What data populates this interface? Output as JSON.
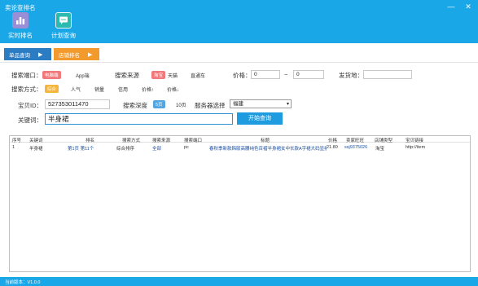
{
  "window": {
    "title": "卖论查排名",
    "minimize": "—",
    "close": "✕"
  },
  "toolbar": {
    "rank_label": "实时排名",
    "plan_label": "计划查询"
  },
  "tabs": [
    {
      "label": "单品查询",
      "arrow": "▶"
    },
    {
      "label": "店铺排名",
      "arrow": "▶"
    }
  ],
  "form": {
    "port_label": "搜索端口：",
    "port_options": [
      "电脑端",
      "App端"
    ],
    "source_label": "搜索来源",
    "source_options": [
      "淘宝",
      "天猫",
      "直通车"
    ],
    "price_label": "价格：",
    "price_min": "0",
    "price_sep": "~",
    "price_max": "0",
    "ship_label": "发货地：",
    "ship_value": "",
    "method_label": "搜索方式：",
    "method_options": [
      "综合",
      "人气",
      "销量",
      "信用",
      "价格↑",
      "价格↓"
    ],
    "item_id_label": "宝贝ID：",
    "item_id_value": "527353011470",
    "depth_label": "搜索深度",
    "depth_options": [
      "5页",
      "10页"
    ],
    "server_label": "服务器选择",
    "server_value": "福建",
    "keyword_label": "关键词：",
    "keyword_value": "半身裙",
    "start_button": "开始查询"
  },
  "table": {
    "headers": [
      "序号",
      "关键词",
      "排名",
      "搜索方式",
      "搜索来源",
      "搜索端口",
      "标题",
      "价格",
      "卖家旺旺",
      "店铺类型",
      "宝贝链接"
    ],
    "rows": [
      [
        "1",
        "半身裙",
        "第1页 第11个",
        "综合排序",
        "全部",
        "pc",
        "春秋季新款韩版高腰纯色百褶半身裙女中长款A字裙大码显瘦",
        "21.80",
        "ssj9375026",
        "淘宝",
        "http://item"
      ]
    ]
  },
  "status": {
    "version": "当前版本：V1.0.0"
  },
  "colors": {
    "brand": "#1aa7e8",
    "tab_active": "#2c7cc4",
    "tab_orange": "#f39a2c",
    "chip_red": "#f07a7a",
    "chip_orange": "#f5b53a",
    "chip_blue": "#53a6e2"
  }
}
